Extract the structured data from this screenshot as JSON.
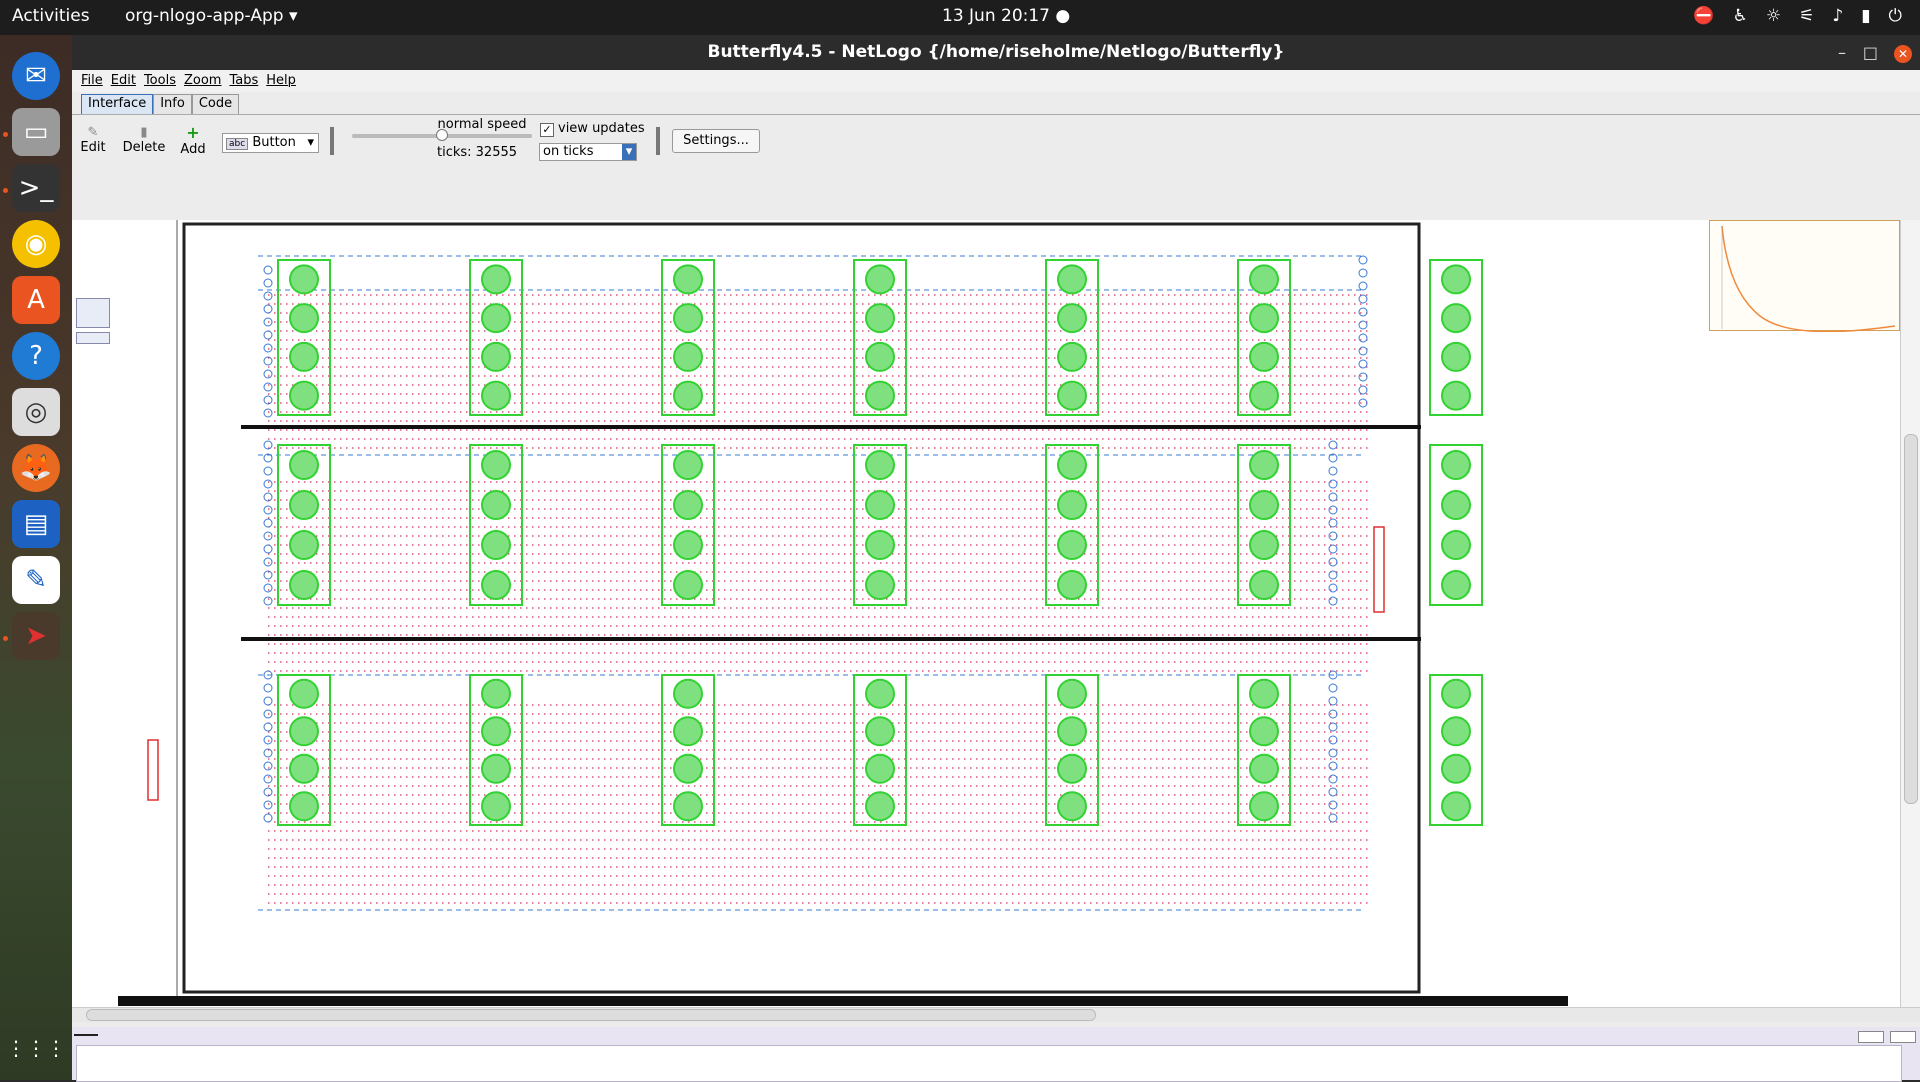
{
  "topbar": {
    "activities": "Activities",
    "app_menu": "org-nlogo-app-App",
    "clock": "13 Jun  20:17"
  },
  "window": {
    "title": "Butterfly4.5 - NetLogo {/home/riseholme/Netlogo/Butterfly}"
  },
  "menu": [
    "File",
    "Edit",
    "Tools",
    "Zoom",
    "Tabs",
    "Help"
  ],
  "tabs": [
    "Interface",
    "Info",
    "Code"
  ],
  "toolbar": {
    "edit_label": "Edit",
    "delete_label": "Delete",
    "add_label": "Add",
    "widget_type": "Button",
    "speed_label": "normal speed",
    "ticks_label": "ticks: 32555",
    "view_updates_label": "view updates",
    "update_mode": "on ticks",
    "settings_label": "Settings..."
  },
  "colors": {
    "accent": "#e95420",
    "plot_line": "#f08a3c",
    "rack_green": "#33d233",
    "aisle_blue": "#3a78d6",
    "patch_red": "#d23060"
  }
}
